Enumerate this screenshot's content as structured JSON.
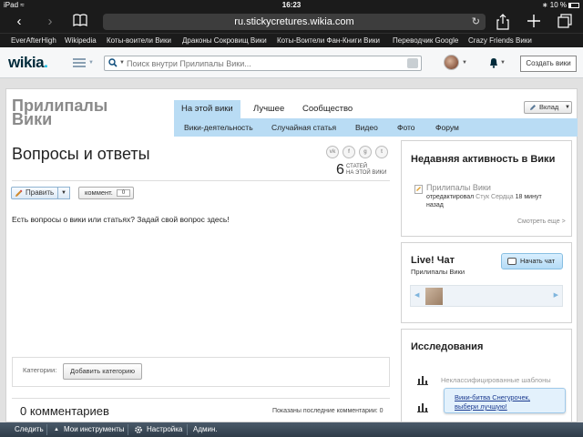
{
  "statusbar": {
    "device": "iPad",
    "time": "16:23",
    "battery": "10 %"
  },
  "safari": {
    "url": "ru.stickycretures.wikia.com",
    "bookmarks": [
      "EverAfterHigh",
      "Wikipedia",
      "Коты-воители Вики",
      "Драконы Сокровищ Вики",
      "Коты-Воители Фан-Книги Вики",
      "Переводчик Google",
      "Crazy Friends Вики"
    ]
  },
  "wikia": {
    "logo": "wikia",
    "search_placeholder": "Поиск внутри Прилипалы Вики...",
    "create_wiki": "Создать вики"
  },
  "wiki": {
    "name_line1": "Прилипалы",
    "name_line2": "Вики",
    "tabs": [
      "На этой вики",
      "Лучшее",
      "Сообщество"
    ],
    "subnav": [
      "Вики-деятельность",
      "Случайная статья",
      "Видео",
      "Фото",
      "Форум"
    ],
    "contribute": "Вклад"
  },
  "article": {
    "title": "Вопросы и ответы",
    "share_icons": [
      "vk",
      "f",
      "g",
      "t"
    ],
    "article_count": "6",
    "count_label_1": "СТАТЕЙ",
    "count_label_2": "НА ЭТОЙ ВИКИ",
    "edit_label": "Править",
    "comments_label": "коммент.",
    "comments_count": "0",
    "body": "Есть вопросы о вики или статьях? Задай свой вопрос здесь!",
    "categories_label": "Категории:",
    "add_category": "Добавить категорию",
    "comments_title": "0 комментариев",
    "comments_shown": "Показаны последние комментарии: 0"
  },
  "rail": {
    "activity_title": "Недавняя активность в Вики",
    "activity_page": "Прилипалы Вики",
    "activity_action": "отредактировал",
    "activity_user": "Стук Сердца",
    "activity_time_1": "18 минут",
    "activity_time_2": "назад",
    "see_more": "Смотреть еще >",
    "chat_title": "Live! Чат",
    "chat_sub": "Прилипалы Вики",
    "chat_button": "Начать чат",
    "explore_title": "Исследования",
    "explore_item": "Неклассифицированные шаблоны",
    "popup_line1": "Вики-битва Снегурочек,",
    "popup_line2": "выбери лучшую!"
  },
  "toolbar": {
    "follow": "Следить",
    "my_tools": "Мои инструменты",
    "customize": "Настройка",
    "admin": "Админ."
  },
  "colors": {
    "accent_blue": "#b9dcf4",
    "brand_dark": "#002a3a",
    "brand_dot": "#00b7e0"
  }
}
